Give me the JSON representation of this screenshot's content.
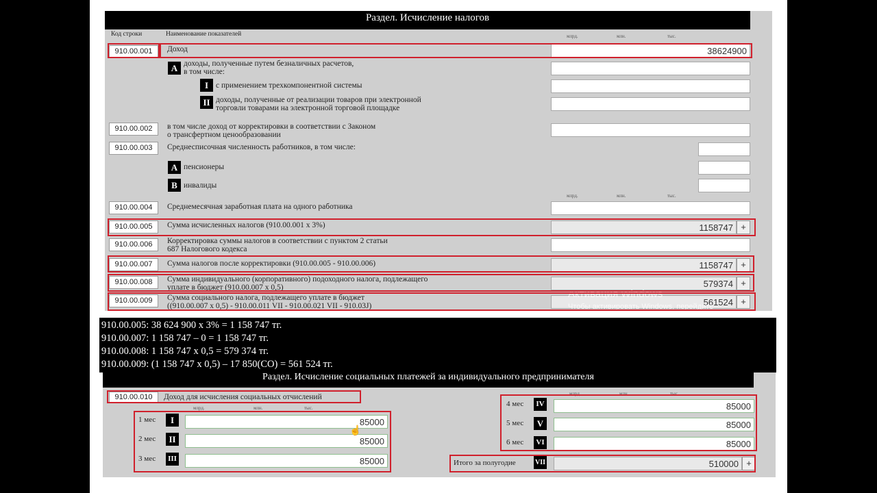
{
  "section1": {
    "title": "Раздел. Исчисление налогов",
    "col_code": "Код строки",
    "col_name": "Наименование показателей",
    "units": {
      "bln": "млрд.",
      "mln": "млн.",
      "thous": "тыс."
    },
    "rows": {
      "r001": {
        "code": "910.00.001",
        "label": "Доход",
        "value": "38624900"
      },
      "r001a": {
        "badge": "A",
        "label1": "доходы, полученные путем безналичных расчетов,",
        "label2": "в том числе:",
        "value": ""
      },
      "r001a1": {
        "badge": "I",
        "label": "с применением трехкомпонентной системы",
        "value": ""
      },
      "r001a2": {
        "badge": "II",
        "label1": "доходы, полученные от реализации товаров при электронной",
        "label2": "торговли товарами на электронной торговой площадке",
        "value": ""
      },
      "r002": {
        "code": "910.00.002",
        "label1": "в том числе доход от корректировки в соответствии с Законом",
        "label2": "о трансфертном ценообразовании",
        "value": ""
      },
      "r003": {
        "code": "910.00.003",
        "label": "Среднесписочная численность работников, в том числе:",
        "value": ""
      },
      "r003a": {
        "badge": "A",
        "label": "пенсионеры",
        "value": ""
      },
      "r003b": {
        "badge": "B",
        "label": "инвалиды",
        "value": ""
      },
      "r004": {
        "code": "910.00.004",
        "label": "Среднемесячная заработная плата на одного работника",
        "value": ""
      },
      "r005": {
        "code": "910.00.005",
        "label": "Сумма исчисленных налогов (910.00.001 х 3%)",
        "value": "1158747"
      },
      "r006": {
        "code": "910.00.006",
        "label1": "Корректировка суммы налогов в соответствии с пунктом 2 статьи",
        "label2": "687 Налогового кодекса",
        "value": ""
      },
      "r007": {
        "code": "910.00.007",
        "label": "Сумма налогов после корректировки (910.00.005 - 910.00.006)",
        "value": "1158747"
      },
      "r008": {
        "code": "910.00.008",
        "label1": "Сумма индивидуального (корпоративного) подоходного налога, подлежащего",
        "label2": "уплате в бюджет (910.00.007 х 0,5)",
        "value": "579374"
      },
      "r009": {
        "code": "910.00.009",
        "label1": "Сумма социального налога, подлежащего уплате в бюджет",
        "label2": "((910.00.007 х 0,5) - 910.00.011 VII - 910.00.021 VII - 910.03J)",
        "value": "561524"
      }
    },
    "plus_label": "+"
  },
  "watermark": {
    "line1": "Активация Windows",
    "line2": "Чтобы активировать Windows, перейдите"
  },
  "notes": [
    "910.00.005: 38 624 900 х 3% = 1 158 747 тг.",
    "910.00.007: 1 158 747 – 0 = 1 158 747 тг.",
    "910.00.008: 1 158 747 х 0,5 = 579 374 тг.",
    "910.00.009: (1 158 747 х 0,5) – 17 850(СО) = 561 524 тг."
  ],
  "section2": {
    "title": "Раздел. Исчисление социальных платежей за индивидуального предпринимателя",
    "code": "910.00.010",
    "label": "Доход для исчисления социальных отчислений",
    "months": [
      {
        "label": "1 мес",
        "badge": "I",
        "value": "85000"
      },
      {
        "label": "2 мес",
        "badge": "II",
        "value": "85000"
      },
      {
        "label": "3 мес",
        "badge": "III",
        "value": "85000"
      },
      {
        "label": "4 мес",
        "badge": "IV",
        "value": "85000"
      },
      {
        "label": "5 мес",
        "badge": "V",
        "value": "85000"
      },
      {
        "label": "6 мес",
        "badge": "VI",
        "value": "85000"
      }
    ],
    "total": {
      "label": "Итого за полугодие",
      "badge": "VII",
      "value": "510000"
    }
  }
}
